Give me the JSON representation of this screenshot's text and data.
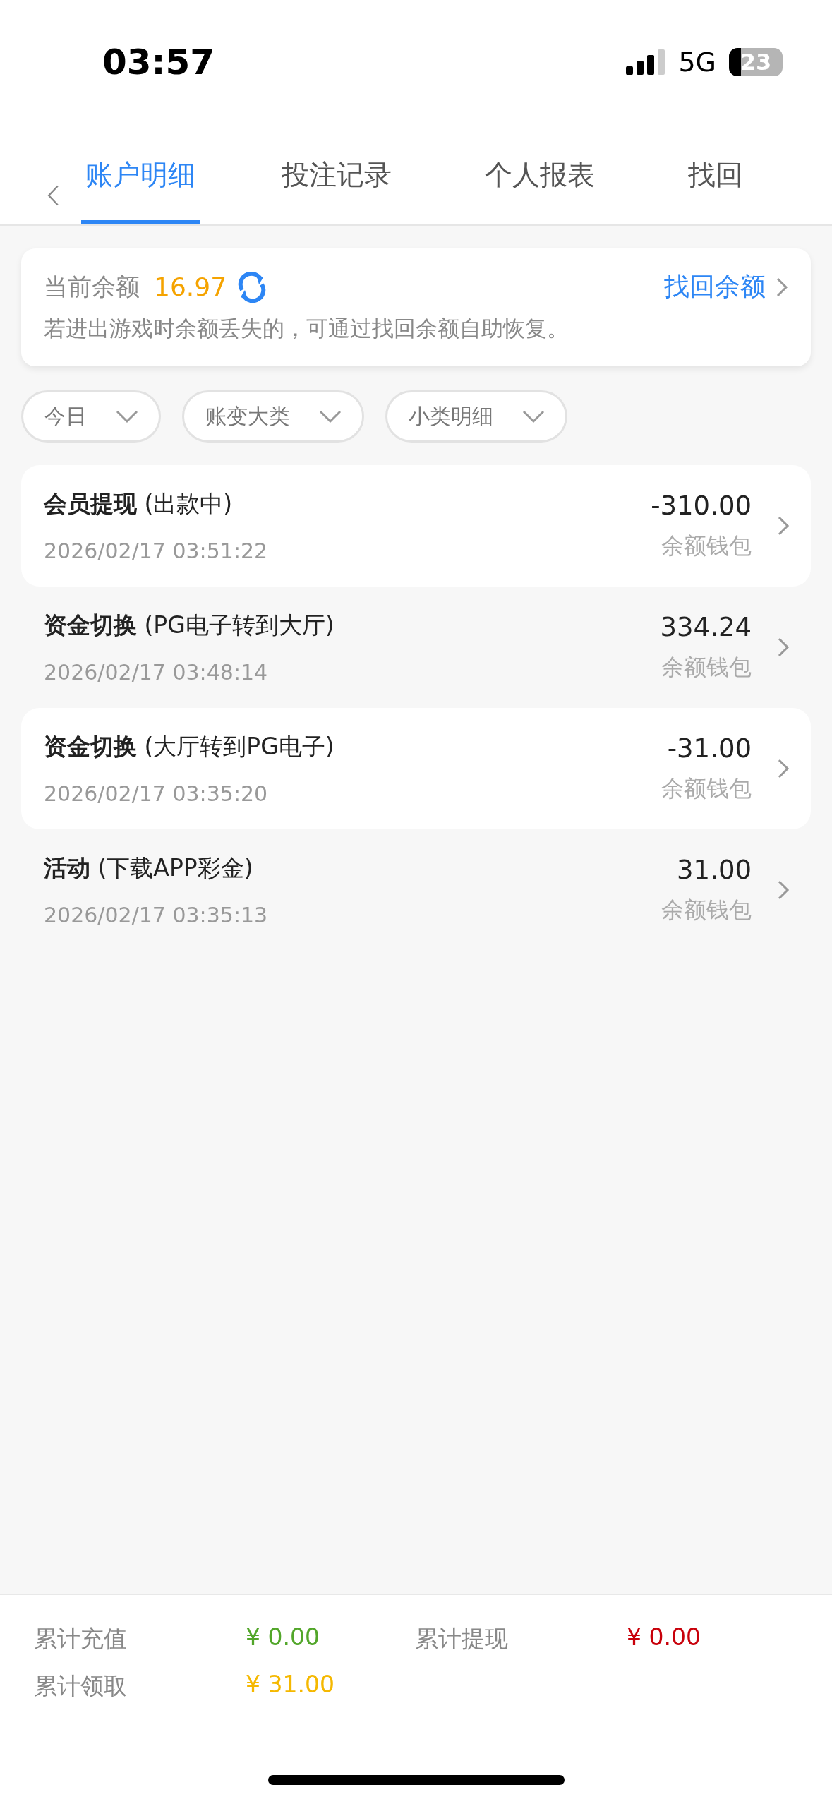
{
  "status_bar": {
    "time": "03:57",
    "network": "5G",
    "battery": "23"
  },
  "tabs": [
    {
      "label": "账户明细",
      "selected": true
    },
    {
      "label": "投注记录",
      "selected": false
    },
    {
      "label": "个人报表",
      "selected": false
    },
    {
      "label": "找回",
      "selected": false
    }
  ],
  "balance_card": {
    "label": "当前余额",
    "amount": "16.97",
    "link": "找回余额",
    "note": "若进出游戏时余额丢失的，可通过找回余额自助恢复。"
  },
  "filters": [
    {
      "label": "今日"
    },
    {
      "label": "账变大类"
    },
    {
      "label": "小类明细"
    }
  ],
  "records": [
    {
      "category": "会员提现",
      "detail": "(出款中)",
      "time": "2026/02/17 03:51:22",
      "amount": "-310.00",
      "wallet": "余额钱包"
    },
    {
      "category": "资金切换",
      "detail": "(PG电子转到大厅)",
      "time": "2026/02/17 03:48:14",
      "amount": "334.24",
      "wallet": "余额钱包"
    },
    {
      "category": "资金切换",
      "detail": "(大厅转到PG电子)",
      "time": "2026/02/17 03:35:20",
      "amount": "-31.00",
      "wallet": "余额钱包"
    },
    {
      "category": "活动",
      "detail": "(下载APP彩金)",
      "time": "2026/02/17 03:35:13",
      "amount": "31.00",
      "wallet": "余额钱包"
    }
  ],
  "totals": [
    {
      "label": "累计充值",
      "value": "¥ 0.00",
      "color": "#52a62a"
    },
    {
      "label": "累计提现",
      "value": "¥ 0.00",
      "color": "#c8000a"
    },
    {
      "label": "累计领取",
      "value": "¥ 31.00",
      "color": "#f5b800"
    }
  ]
}
